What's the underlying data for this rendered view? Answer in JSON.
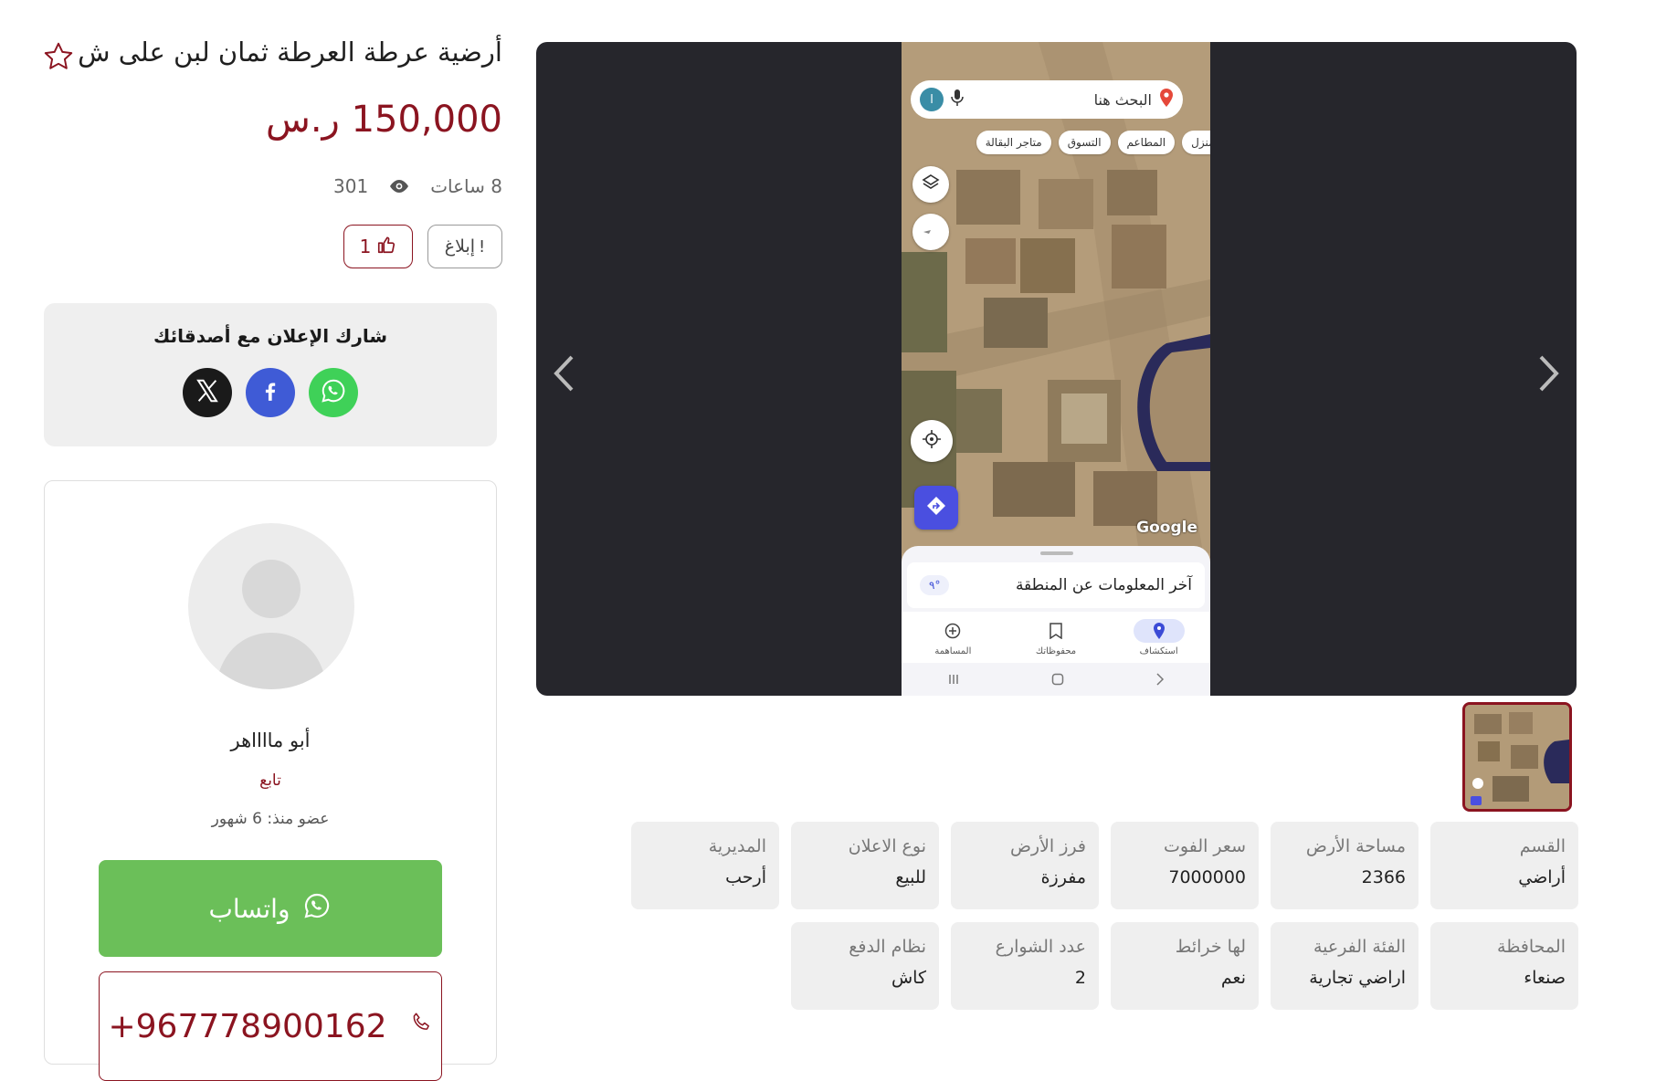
{
  "listing": {
    "title": "أرضية عرطة العرطة ثمان لبن على ش",
    "price": "150,000 ر.س",
    "posted": "8 ساعات",
    "views": "301",
    "report_label": "إبلاغ",
    "likes": "1"
  },
  "share": {
    "title": "شارك الإعلان مع أصدقائك"
  },
  "seller": {
    "name": "أبو مااااهر",
    "follow_label": "تابع",
    "member_since": "عضو منذ: 6 شهور",
    "whatsapp_label": "واتساب",
    "phone": "+967778900162"
  },
  "gallery_image": {
    "search_placeholder": "البحث هنا",
    "user_initial": "ا",
    "chips": [
      "المنزل",
      "المطاعم",
      "التسوق",
      "متاجر البقالة"
    ],
    "google_mark": "Google",
    "sheet_title": "آخر المعلومات عن المنطقة",
    "weather": "٩°",
    "nav": [
      "استكشاف",
      "محفوظاتك",
      "المساهمة"
    ]
  },
  "details": [
    {
      "label": "القسم",
      "value": "أراضي"
    },
    {
      "label": "مساحة الأرض",
      "value": "2366"
    },
    {
      "label": "سعر الفوت",
      "value": "7000000"
    },
    {
      "label": "فرز الأرض",
      "value": "مفرزة"
    },
    {
      "label": "نوع الاعلان",
      "value": "للبيع"
    },
    {
      "label": "المديرية",
      "value": "أرحب"
    },
    {
      "label": "المحافظة",
      "value": "صنعاء"
    },
    {
      "label": "الفئة الفرعية",
      "value": "اراضي تجارية"
    },
    {
      "label": "لها خرائط",
      "value": "نعم"
    },
    {
      "label": "عدد الشوارع",
      "value": "2"
    },
    {
      "label": "نظام الدفع",
      "value": "كاش"
    }
  ],
  "colors": {
    "accent": "#8b1420",
    "whatsapp_button": "#6bbf59",
    "gallery_bg": "#26262c",
    "panel_bg": "#efefef"
  }
}
